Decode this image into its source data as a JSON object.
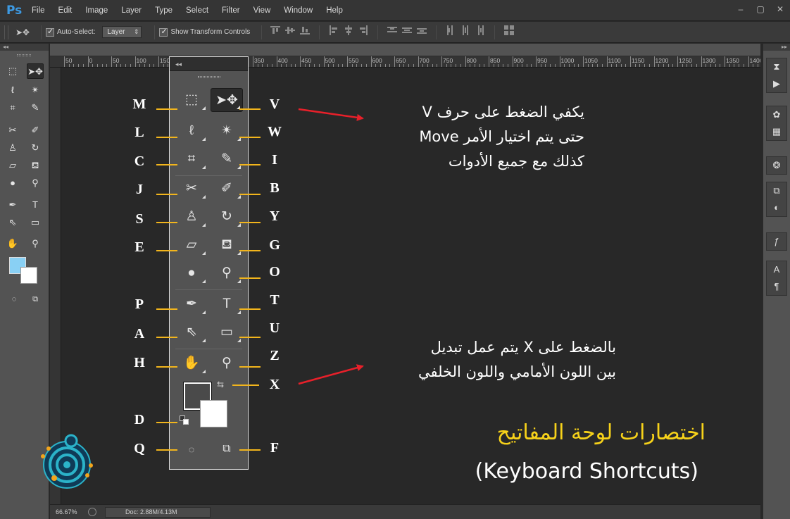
{
  "app": {
    "logo_text": "Ps"
  },
  "menu": {
    "items": [
      "File",
      "Edit",
      "Image",
      "Layer",
      "Type",
      "Select",
      "Filter",
      "View",
      "Window",
      "Help"
    ]
  },
  "window_controls": [
    "–",
    "▢",
    "✕"
  ],
  "options_bar": {
    "move_icon": "➤✥",
    "auto_select_label": "Auto-Select:",
    "auto_select_value": "Layer",
    "show_transform_label": "Show Transform Controls"
  },
  "ruler": {
    "labels": [
      "50",
      "0",
      "50",
      "100",
      "150",
      "200",
      "250",
      "300",
      "350",
      "400",
      "450",
      "500",
      "550",
      "600",
      "650",
      "700",
      "750",
      "800",
      "850",
      "900",
      "950",
      "1000",
      "1050",
      "1100",
      "1150",
      "1200",
      "1250",
      "1300",
      "1350",
      "1400"
    ]
  },
  "status_bar": {
    "zoom": "66.67%",
    "doc": "Doc: 2.88M/4.13M"
  },
  "panel_collapse": {
    "left": "◂◂",
    "right": "▸▸",
    "toolbox": "◂◂"
  },
  "toolbox": {
    "tools": [
      {
        "name": "marquee",
        "glyph": "⬚",
        "key": "M"
      },
      {
        "name": "move",
        "glyph": "➤✥",
        "key": "V"
      },
      {
        "name": "lasso",
        "glyph": "ℓ",
        "key": "L"
      },
      {
        "name": "magic-wand",
        "glyph": "✴",
        "key": "W"
      },
      {
        "name": "crop",
        "glyph": "⌗",
        "key": "C"
      },
      {
        "name": "eyedropper",
        "glyph": "✎",
        "key": "I"
      },
      {
        "name": "healing",
        "glyph": "✂",
        "key": "J"
      },
      {
        "name": "brush",
        "glyph": "✐",
        "key": "B"
      },
      {
        "name": "stamp",
        "glyph": "♙",
        "key": "S"
      },
      {
        "name": "history-brush",
        "glyph": "↻",
        "key": "Y"
      },
      {
        "name": "eraser",
        "glyph": "▱",
        "key": "E"
      },
      {
        "name": "paint-bucket",
        "glyph": "⛾",
        "key": "G"
      },
      {
        "name": "blur",
        "glyph": "●",
        "key": ""
      },
      {
        "name": "dodge",
        "glyph": "⚲",
        "key": "O"
      },
      {
        "name": "pen",
        "glyph": "✒",
        "key": "P"
      },
      {
        "name": "type",
        "glyph": "T",
        "key": "T"
      },
      {
        "name": "path-select",
        "glyph": "⇖",
        "key": "A"
      },
      {
        "name": "shape",
        "glyph": "▭",
        "key": "U"
      },
      {
        "name": "hand",
        "glyph": "✋",
        "key": "H"
      },
      {
        "name": "zoom",
        "glyph": "⚲",
        "key": "Z"
      }
    ],
    "swap_key": "X",
    "default_colors_key": "D",
    "quick_mask_key": "Q",
    "screen_mode_key": "F",
    "swap_glyph": "⇆",
    "quick_mask_glyph": "◌",
    "screen_mode_glyph": "⧉"
  },
  "colors": {
    "foreground": "#4a4a4a",
    "background": "#ffffff",
    "left_foreground": "#89d0f4",
    "accent_line": "#f2b51c",
    "arrow": "#e8202a",
    "title": "#f7d21a"
  },
  "annotations": {
    "move_tip": [
      "يكفي الضغط على حرف V",
      "حتى يتم اختيار الأمر Move",
      "كذلك مع جميع الأدوات"
    ],
    "swap_tip": [
      "بالضغط على X يتم عمل تبديل",
      "بين اللون الأمامي واللون الخلفي"
    ],
    "title_ar": "اختصارات لوحة المفاتيح",
    "title_en": "(Keyboard Shortcuts)"
  },
  "right_dock_icons": [
    "history-icon",
    "play-icon",
    "palette-icon",
    "swatches-icon",
    "adjust-icon",
    "layers-icon",
    "channels-icon",
    "fx-icon",
    "character-icon",
    "paragraph-icon"
  ]
}
